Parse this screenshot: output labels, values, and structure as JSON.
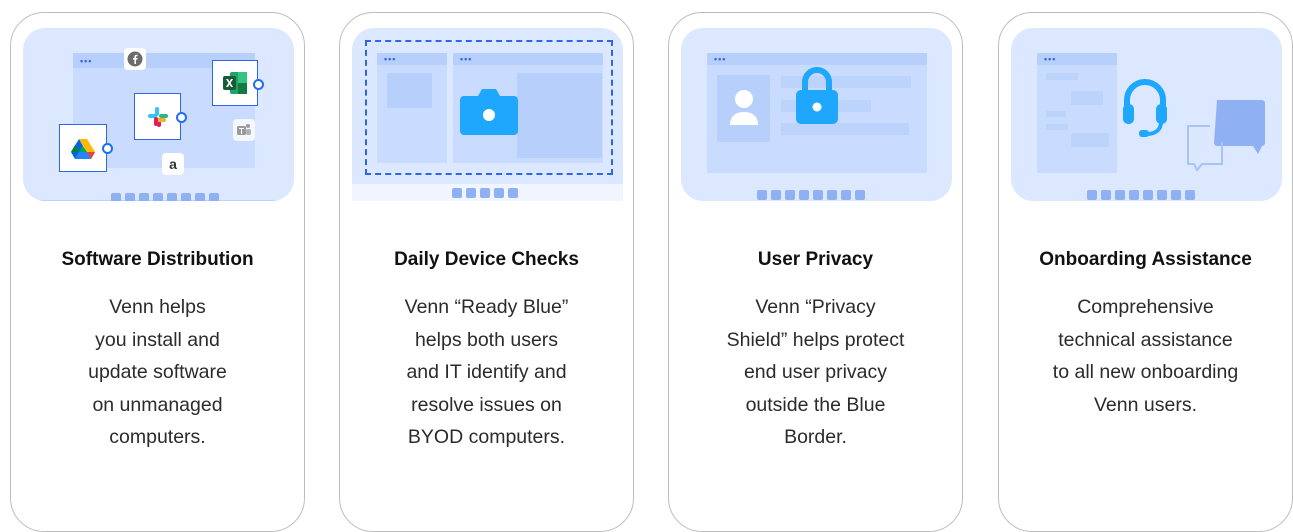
{
  "cards": [
    {
      "title": "Software Distribution",
      "desc": [
        "Venn helps",
        "you install and",
        "update software",
        "on unmanaged",
        "computers."
      ],
      "art": {
        "amazon_letter": "a"
      }
    },
    {
      "title": "Daily Device Checks",
      "desc": [
        "Venn “Ready Blue”",
        "helps both users",
        "and IT identify and",
        "resolve issues on",
        "BYOD computers."
      ]
    },
    {
      "title": "User Privacy",
      "desc": [
        "Venn “Privacy",
        "Shield” helps protect",
        "end user privacy",
        "outside the Blue",
        "Border."
      ]
    },
    {
      "title": "Onboarding Assistance",
      "desc": [
        "Comprehensive",
        "technical assistance",
        "to all new onboarding",
        "Venn users."
      ]
    }
  ],
  "colors": {
    "accent": "#1ea7fd",
    "brand_blue": "#2f66e8",
    "panel": "#dbe8ff",
    "window": "#c9dcff",
    "taskbar": "#8fb0f2",
    "border": "#bdbdbd"
  },
  "icons": [
    "facebook-icon",
    "excel-icon",
    "slack-icon",
    "google-drive-icon",
    "teams-icon",
    "amazon-icon",
    "camera-icon",
    "user-icon",
    "lock-icon",
    "headset-icon",
    "chat-bubble-icon"
  ]
}
